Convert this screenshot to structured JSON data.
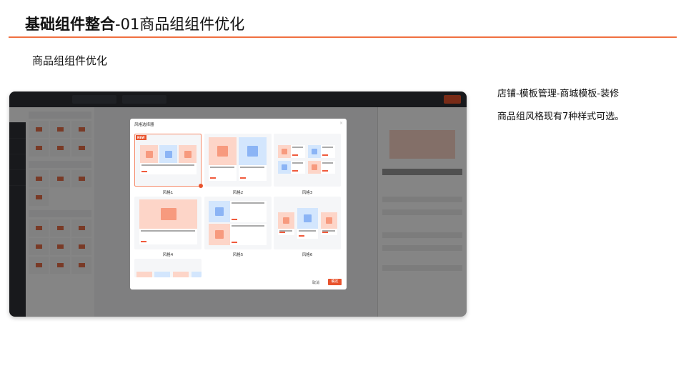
{
  "slide": {
    "title_bold": "基础组件整合",
    "title_rest": "-01商品组组件优化",
    "subtitle": "商品组组件优化",
    "path_note": "店铺-模板管理-商城模板-装修",
    "desc_note": "商品组风格现有7种样式可选。",
    "accent_color": "#f07040"
  },
  "modal": {
    "title": "风格选择器",
    "new_badge": "NEW",
    "styles": [
      "风格1",
      "风格2",
      "风格3",
      "风格4",
      "风格5",
      "风格6"
    ],
    "selected_style": "风格1",
    "cancel_label": "取消",
    "confirm_label": "确定",
    "primary_color": "#e8532d"
  }
}
